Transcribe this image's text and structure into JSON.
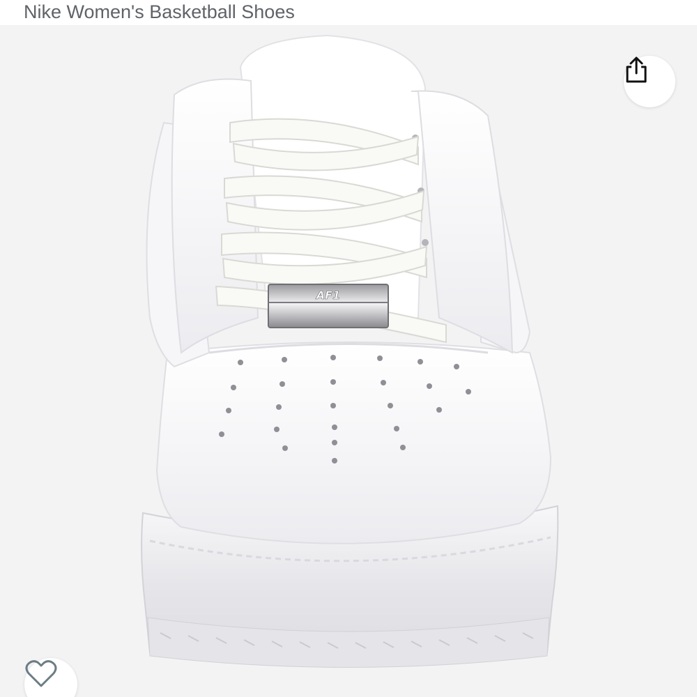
{
  "product": {
    "title": "Nike Women's Basketball Shoes",
    "image_alt": "White platform low-top sneaker, front view",
    "tag_text": "AF1"
  },
  "actions": {
    "share_icon": "share-icon",
    "wishlist_icon": "heart-outline-icon"
  },
  "colors": {
    "title_text": "#5f6368",
    "image_background": "#f3f3f4",
    "icon_stroke": "#111111",
    "heart_stroke": "#6b7c85"
  }
}
